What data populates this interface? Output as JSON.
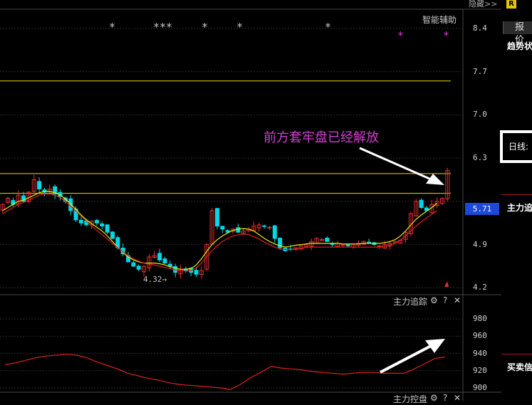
{
  "top_bar": {
    "hide_label": "隐藏>>",
    "badge": "R"
  },
  "main_chart": {
    "assist_label": "智能辅助",
    "star_marks": [
      "*",
      "***",
      "*",
      "*",
      "*"
    ],
    "magenta_marks": [
      "*",
      "*"
    ],
    "current_price": "5.71",
    "annotation": "前方套牢盘已经解放",
    "low_label": "4.32",
    "colors": {
      "up": "#e03030",
      "down": "#00d8e8",
      "ma_short": "#e8e800",
      "ma_long": "#e02020",
      "level": "#e8e000",
      "annotation": "#d040d0"
    }
  },
  "chart_data": [
    {
      "type": "candlestick",
      "y_ticks": [
        8.4,
        7.7,
        7.0,
        6.3,
        5.6,
        4.9,
        4.2
      ],
      "y_tick_labels": [
        "8.4",
        "7.7",
        "7.0",
        "6.3",
        "",
        "4.9",
        "4.2"
      ],
      "ylim": [
        4.1,
        8.7
      ],
      "horizontal_levels": [
        7.55,
        6.05,
        5.73
      ],
      "current_price": 5.71,
      "low": 4.32,
      "closes": [
        5.55,
        5.65,
        5.55,
        5.7,
        5.6,
        5.75,
        5.95,
        5.8,
        5.75,
        5.8,
        5.72,
        5.68,
        5.6,
        5.45,
        5.3,
        5.25,
        5.22,
        5.28,
        5.25,
        5.2,
        5.1,
        5.0,
        4.85,
        4.75,
        4.62,
        4.55,
        4.5,
        4.55,
        4.7,
        4.72,
        4.65,
        4.6,
        4.55,
        4.45,
        4.5,
        4.48,
        4.45,
        4.42,
        4.48,
        4.9,
        5.45,
        5.2,
        5.15,
        5.1,
        5.15,
        5.1,
        5.12,
        5.15,
        5.2,
        5.22,
        5.2,
        5.18,
        5.0,
        4.85,
        4.8,
        4.82,
        4.85,
        4.88,
        4.9,
        4.95,
        5.0,
        4.98,
        4.95,
        4.9,
        4.92,
        4.9,
        4.88,
        4.9,
        4.92,
        4.95,
        4.93,
        4.9,
        4.88,
        4.9,
        4.92,
        4.95,
        4.97,
        5.1,
        5.4,
        5.6,
        5.5,
        5.45,
        5.55,
        5.6,
        5.65,
        6.1
      ],
      "ma_short": [
        5.45,
        5.5,
        5.55,
        5.6,
        5.62,
        5.66,
        5.7,
        5.74,
        5.76,
        5.76,
        5.74,
        5.7,
        5.64,
        5.56,
        5.47,
        5.38,
        5.3,
        5.24,
        5.18,
        5.12,
        5.04,
        4.95,
        4.86,
        4.77,
        4.7,
        4.65,
        4.62,
        4.6,
        4.6,
        4.6,
        4.59,
        4.57,
        4.54,
        4.52,
        4.5,
        4.5,
        4.51,
        4.57,
        4.67,
        4.79,
        4.9,
        4.98,
        5.04,
        5.09,
        5.13,
        5.15,
        5.16,
        5.15,
        5.12,
        5.06,
        5.0,
        4.95,
        4.91,
        4.88,
        4.86,
        4.87,
        4.89,
        4.9,
        4.91,
        4.92,
        4.92,
        4.92,
        4.92,
        4.92,
        4.92,
        4.91,
        4.91,
        4.91,
        4.91,
        4.92,
        4.92,
        4.92,
        4.92,
        4.93,
        4.95,
        4.98,
        5.04,
        5.12,
        5.22,
        5.31,
        5.38,
        5.44,
        5.5,
        5.57
      ],
      "ma_long": [
        5.4,
        5.45,
        5.5,
        5.55,
        5.58,
        5.62,
        5.66,
        5.7,
        5.72,
        5.72,
        5.7,
        5.66,
        5.6,
        5.52,
        5.44,
        5.36,
        5.28,
        5.2,
        5.13,
        5.06,
        4.99,
        4.92,
        4.85,
        4.78,
        4.72,
        4.67,
        4.63,
        4.6,
        4.58,
        4.57,
        4.55,
        4.53,
        4.51,
        4.49,
        4.48,
        4.47,
        4.48,
        4.52,
        4.6,
        4.7,
        4.8,
        4.88,
        4.95,
        5.0,
        5.04,
        5.06,
        5.07,
        5.06,
        5.03,
        4.99,
        4.94,
        4.9,
        4.86,
        4.83,
        4.82,
        4.82,
        4.83,
        4.84,
        4.85,
        4.86,
        4.86,
        4.86,
        4.86,
        4.86,
        4.86,
        4.86,
        4.86,
        4.86,
        4.86,
        4.86,
        4.86,
        4.86,
        4.86,
        4.87,
        4.89,
        4.92,
        4.97,
        5.04,
        5.12,
        5.2,
        5.27,
        5.33,
        5.39,
        5.45
      ]
    },
    {
      "type": "line",
      "title": "主力追踪",
      "y_ticks": [
        980,
        960,
        940,
        920,
        900
      ],
      "ylim": [
        895,
        995
      ],
      "values": [
        927,
        929,
        932,
        935,
        937,
        938,
        939,
        938,
        935,
        930,
        926,
        922,
        917,
        914,
        911,
        909,
        906,
        904,
        903,
        902,
        901,
        900,
        898,
        904,
        912,
        918,
        925,
        923,
        922,
        921,
        919,
        918,
        917,
        916,
        917,
        918,
        918,
        917,
        917,
        917,
        922,
        928,
        934,
        936
      ]
    }
  ],
  "sub_panel": {
    "title": "主力追踪",
    "gear_icon": "⚙",
    "help_icon": "?",
    "close_icon": "✕"
  },
  "sub_panel2": {
    "title": "主力控盘"
  },
  "right_panel": {
    "quote_tab": "报价",
    "trend_label": "趋势状",
    "daily_label": "日线:",
    "main_label": "主力追",
    "trade_label": "买卖信"
  }
}
